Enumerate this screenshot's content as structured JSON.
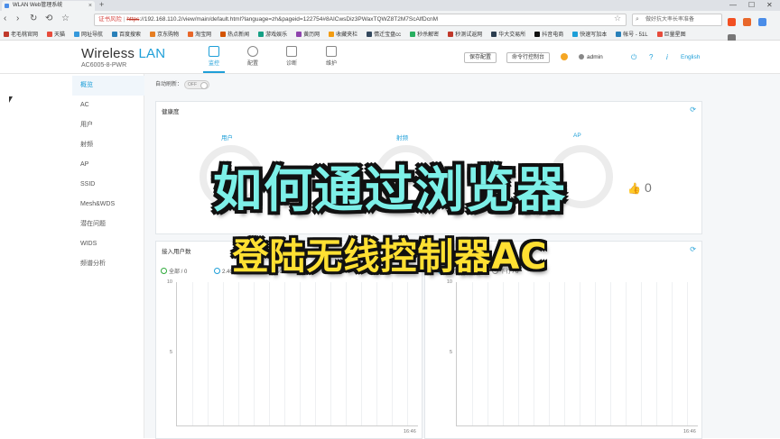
{
  "browser": {
    "tab_title": "WLAN Web管理系统",
    "new_tab": "+",
    "window_controls": [
      "—",
      "☐",
      "✕"
    ],
    "nav": {
      "back": "‹",
      "forward": "›",
      "reload": "↻",
      "home": "⟲",
      "bookmark": "☆"
    },
    "address": {
      "security_warning": "证书风险",
      "protocol": "https",
      "url": "://192.168.110.2/view/main/default.html?language=zh&pageid=122754#8AICwsDiz3PWaxTQWZ8T2M7ScAlfDcnM"
    },
    "search_box": "做好抗大率长率准备",
    "bookmarks": [
      "老毛桃官网",
      "天猫",
      "网址导航",
      "百度搜索",
      "京东购物",
      "淘宝网",
      "热点新闻",
      "游戏娱乐",
      "黄历网",
      "收藏夹栏",
      "情迁宝盘cc",
      "秒杀解密",
      "秒测试返网",
      "华大交易所",
      "抖音电商",
      "快速写加本",
      "帐号 - 51L",
      "巨量星图"
    ]
  },
  "app": {
    "brand": {
      "prefix": "Wireless",
      "accent": "LAN"
    },
    "model": "AC6005-8-PWR",
    "main_tabs": [
      {
        "label": "监控",
        "icon": "monitor-icon",
        "active": true
      },
      {
        "label": "配置",
        "icon": "gear-icon",
        "active": false
      },
      {
        "label": "诊断",
        "icon": "diagnose-icon",
        "active": false
      },
      {
        "label": "维护",
        "icon": "maintain-icon",
        "active": false
      }
    ],
    "header_buttons": {
      "save": "保存配置",
      "cli": "命令行控制台"
    },
    "user": "admin",
    "header_icons": {
      "logout": "⏻",
      "help": "?",
      "info": "i"
    },
    "language": "English",
    "accent_color": "#1e9fd8"
  },
  "sidebar": {
    "items": [
      "概览",
      "AC",
      "用户",
      "射频",
      "AP",
      "SSID",
      "Mesh&WDS",
      "潜在问题",
      "WIDS",
      "频谱分析"
    ]
  },
  "content": {
    "auto_refresh_label": "自动刷新：",
    "auto_refresh_state": "OFF",
    "health_panel": {
      "title": "健康度",
      "labels": [
        "用户",
        "射频",
        "AP"
      ],
      "thumb_value": "0"
    },
    "users_panel": {
      "title": "接入用户数",
      "legend": [
        "全部 / 0",
        "2.4G / 0",
        "5G / 0"
      ],
      "legend_right": [
        "上行 / 0",
        "下行 / 0"
      ],
      "y_ticks": [
        "10",
        "5",
        "0"
      ],
      "x_time": "16:46"
    }
  },
  "overlay": {
    "title_line1": "如何通过浏览器",
    "title_line2": "登陆无线控制器AC"
  }
}
